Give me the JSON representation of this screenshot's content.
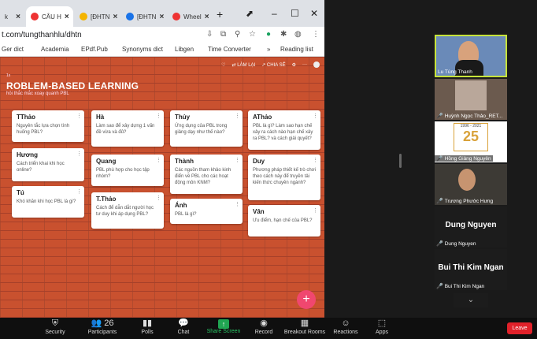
{
  "browser": {
    "tabs": [
      {
        "label": "k",
        "fav": "#888"
      },
      {
        "label": "CÂU H",
        "fav": "#e33"
      },
      {
        "label": "[ĐHTN",
        "fav": "#f4b400"
      },
      {
        "label": "[ĐHTN",
        "fav": "#1a73e8"
      },
      {
        "label": "Wheel",
        "fav": "#e33"
      }
    ],
    "new_tab": "+",
    "url": "t.com/tungthanhlu/dhtn",
    "bookmarks": [
      "Ger dict",
      "Academia",
      "EPdf.Pub",
      "Synonyms dict",
      "Libgen",
      "Time Converter",
      "»",
      "Reading list"
    ]
  },
  "padlet": {
    "top_actions": [
      "♡",
      "⇄ LÀM LẠI",
      "↗ CHIA SẺ",
      "⚙",
      "···"
    ],
    "pre": "1s",
    "title": "ROBLEM-BASED LEARNING",
    "subtitle": "hỏi thắc mắc xoay quanh PBL",
    "cards": [
      {
        "name": "TThảo",
        "text": "Nguyên tắc lựa chọn tình huống PBL?"
      },
      {
        "name": "Hương",
        "text": "Cách triển khai khi học online?"
      },
      {
        "name": "Tú",
        "text": "Khó khăn khi học PBL là gì?"
      },
      {
        "name": "Hà",
        "text": "Làm sao để xây dựng 1 vấn đề vừa và đủ?"
      },
      {
        "name": "Quang",
        "text": "PBL phù hợp cho học tập nhóm?"
      },
      {
        "name": "T.Thảo",
        "text": "Cách để dẫn dắt người học tư duy khi áp dụng PBL?"
      },
      {
        "name": "Thủy",
        "text": "Ứng dụng của PBL trong giảng dạy như thế nào?"
      },
      {
        "name": "Thành",
        "text": "Các nguồn tham khảo kinh điển về PBL cho các hoạt động môn KNM?"
      },
      {
        "name": "Ánh",
        "text": "PBL là gì?"
      },
      {
        "name": "AThảo",
        "text": "PBL là gì? Làm sao hạn chế xảy ra cách nào hạn chế xảy ra PBL? và cách giải quyết?"
      },
      {
        "name": "Duy",
        "text": "Phương pháp thiết kế trò chơi theo cách này để truyền tải kiến thức chuyên ngành?"
      },
      {
        "name": "Vân",
        "text": "Ưu điểm, hạn chế của PBL?"
      }
    ],
    "fab": "+"
  },
  "gallery": [
    {
      "name": "Lu Tùng Thanh",
      "big": ""
    },
    {
      "name": "Huỳnh Ngọc Thảo_RET...",
      "big": ""
    },
    {
      "name": "Hồng Giảng Nguyên",
      "big": ""
    },
    {
      "name": "Trương Phước Hưng",
      "big": ""
    },
    {
      "name": "Dung Nguyen",
      "big": "Dung Nguyen"
    },
    {
      "name": "Bui Thi Kim Ngan",
      "big": "Bui Thi Kim Ngan"
    }
  ],
  "badge_years": "1996 - 2021",
  "badge_num": "25",
  "controls": [
    {
      "icon": "shield-icon",
      "glyph": "⛨",
      "label": "Security"
    },
    {
      "icon": "participants-icon",
      "glyph": "👥 26",
      "label": "Participants"
    },
    {
      "icon": "polls-icon",
      "glyph": "▮▮",
      "label": "Polls"
    },
    {
      "icon": "chat-icon",
      "glyph": "💬",
      "label": "Chat"
    },
    {
      "icon": "share-screen-icon",
      "glyph": "↑",
      "label": "Share Screen"
    },
    {
      "icon": "record-icon",
      "glyph": "◉",
      "label": "Record"
    },
    {
      "icon": "breakout-rooms-icon",
      "glyph": "▦",
      "label": "Breakout Rooms"
    },
    {
      "icon": "reactions-icon",
      "glyph": "☺",
      "label": "Reactions"
    },
    {
      "icon": "apps-icon",
      "glyph": "⬚",
      "label": "Apps"
    }
  ],
  "leave": "Leave"
}
